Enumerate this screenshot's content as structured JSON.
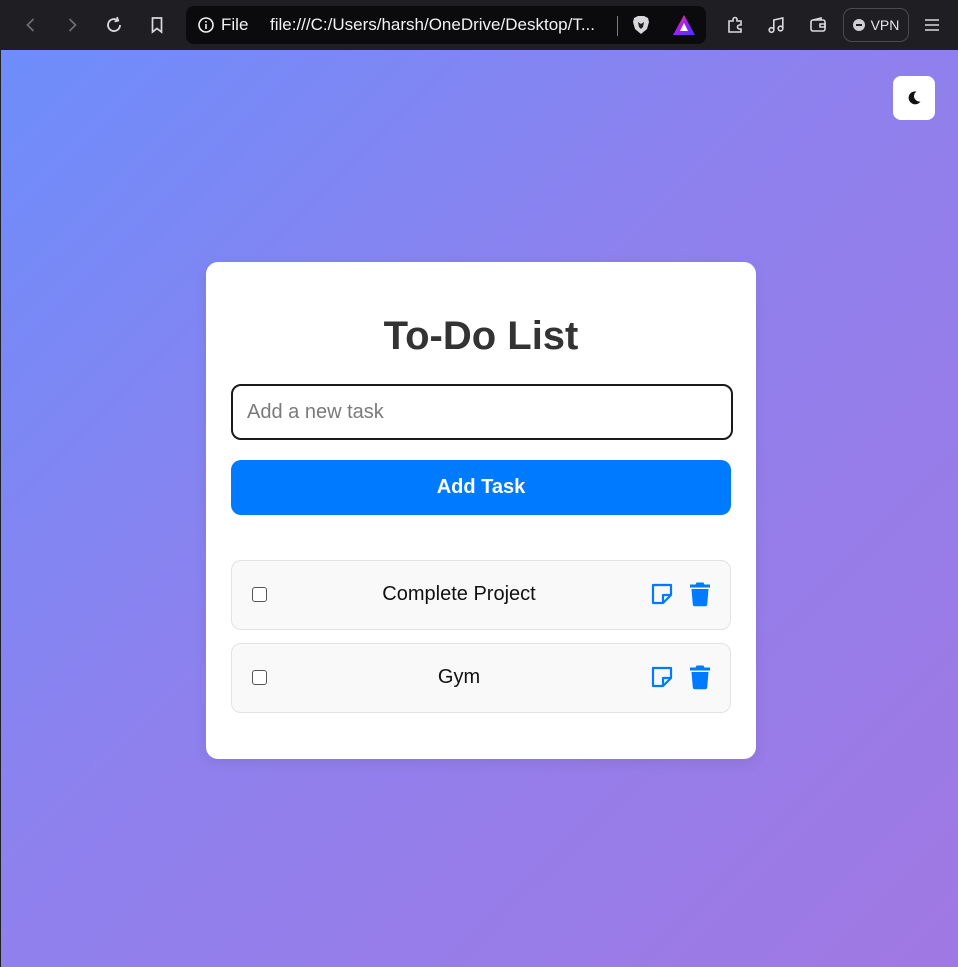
{
  "browser": {
    "scheme_label": "File",
    "url": "file:///C:/Users/harsh/OneDrive/Desktop/T...",
    "vpn_label": "VPN",
    "icons": [
      "back-icon",
      "forward-icon",
      "reload-icon",
      "bookmark-icon",
      "info-icon",
      "brave-shields-icon",
      "brave-rewards-icon",
      "extensions-icon",
      "media-icon",
      "wallet-icon",
      "menu-icon"
    ]
  },
  "app": {
    "title": "To-Do List",
    "input": {
      "placeholder": "Add a new task",
      "value": ""
    },
    "add_button_label": "Add Task",
    "theme_toggle_icon": "moon-icon",
    "accent_color": "#007bff",
    "tasks": [
      {
        "label": "Complete Project",
        "done": false
      },
      {
        "label": "Gym",
        "done": false
      }
    ]
  }
}
